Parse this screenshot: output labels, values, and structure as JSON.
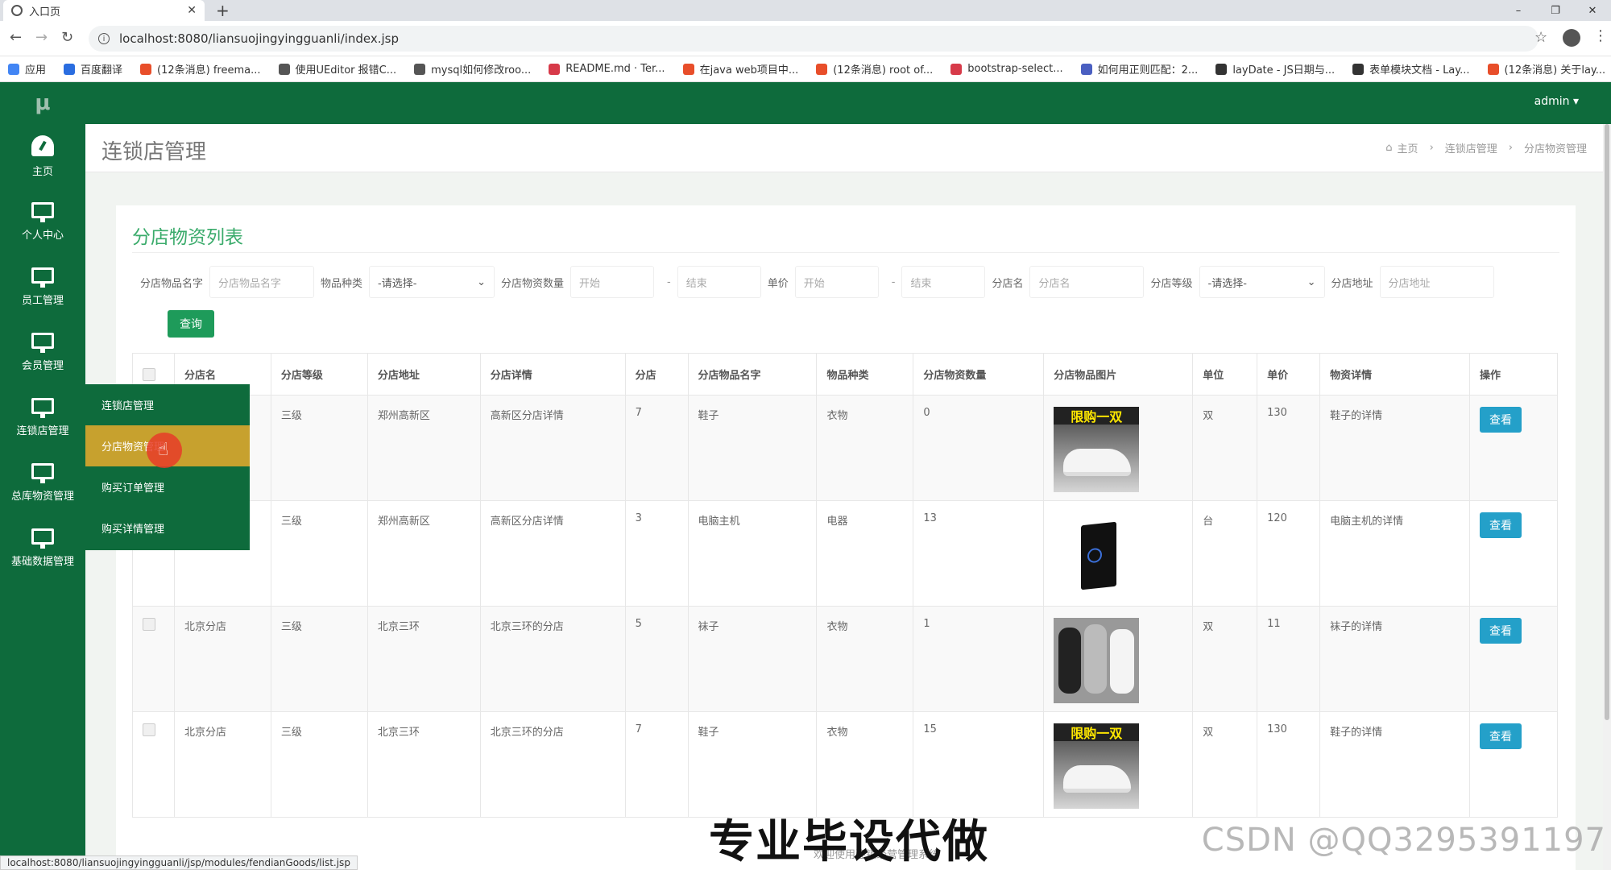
{
  "browser": {
    "tab_title": "入口页",
    "new_tab": "+",
    "url": "localhost:8080/liansuojingyingguanli/index.jsp",
    "window_controls": [
      "–",
      "❐",
      "✕"
    ],
    "bookmarks": [
      {
        "label": "应用",
        "color": "#4285f4"
      },
      {
        "label": "百度翻译",
        "color": "#2a6de0"
      },
      {
        "label": "(12条消息) freema...",
        "color": "#e84e2a"
      },
      {
        "label": "使用UEditor 报错C...",
        "color": "#555555"
      },
      {
        "label": "mysql如何修改roo...",
        "color": "#555555"
      },
      {
        "label": "README.md · Ter...",
        "color": "#d73a49"
      },
      {
        "label": "在java web项目中...",
        "color": "#e84e2a"
      },
      {
        "label": "(12条消息) root of...",
        "color": "#e84e2a"
      },
      {
        "label": "bootstrap-select...",
        "color": "#d73a49"
      },
      {
        "label": "如何用正则匹配：2...",
        "color": "#4a5fc1"
      },
      {
        "label": "layDate - JS日期与...",
        "color": "#333333"
      },
      {
        "label": "表单模块文档 - Lay...",
        "color": "#333333"
      },
      {
        "label": "(12条消息) 关于lay...",
        "color": "#e84e2a"
      }
    ],
    "status_url": "localhost:8080/liansuojingyingguanli/jsp/modules/fendianGoods/list.jsp"
  },
  "sidebar": {
    "logo": "μ",
    "items": [
      {
        "label": "主页",
        "icon": "dashboard-icon"
      },
      {
        "label": "个人中心",
        "icon": "monitor-icon"
      },
      {
        "label": "员工管理",
        "icon": "monitor-icon"
      },
      {
        "label": "会员管理",
        "icon": "monitor-icon"
      },
      {
        "label": "连锁店管理",
        "icon": "monitor-icon"
      },
      {
        "label": "总库物资管理",
        "icon": "monitor-icon"
      },
      {
        "label": "基础数据管理",
        "icon": "monitor-icon"
      }
    ]
  },
  "flyout": {
    "items": [
      {
        "label": "连锁店管理",
        "active": false
      },
      {
        "label": "分店物资管理",
        "active": true
      },
      {
        "label": "购买订单管理",
        "active": false
      },
      {
        "label": "购买详情管理",
        "active": false
      }
    ]
  },
  "topbar": {
    "user": "admin ▾"
  },
  "page": {
    "title": "连锁店管理",
    "breadcrumb": [
      "主页",
      "连锁店管理",
      "分店物资管理"
    ]
  },
  "card": {
    "title": "分店物资列表"
  },
  "search": {
    "goods_name_label": "分店物品名字",
    "goods_name_placeholder": "分店物品名字",
    "type_label": "物品种类",
    "type_value": "-请选择-",
    "qty_label": "分店物资数量",
    "qty_start": "开始",
    "qty_end": "结束",
    "price_label": "单价",
    "price_start": "开始",
    "price_end": "结束",
    "shop_label": "分店名",
    "shop_placeholder": "分店名",
    "level_label": "分店等级",
    "level_value": "-请选择-",
    "addr_label": "分店地址",
    "addr_placeholder": "分店地址",
    "dash": "-",
    "query_button": "查询"
  },
  "table": {
    "headers": [
      "分店名",
      "分店等级",
      "分店地址",
      "分店详情",
      "分店",
      "分店物品名字",
      "物品种类",
      "分店物资数量",
      "分店物品图片",
      "单位",
      "单价",
      "物资详情",
      "操作"
    ],
    "view_label": "查看",
    "rows": [
      {
        "shop": "",
        "level": "三级",
        "addr": "郑州高新区",
        "detail": "高新区分店详情",
        "shop_no": "7",
        "goods": "鞋子",
        "type": "衣物",
        "qty": "0",
        "img": "shoe",
        "img_banner": "限购一双",
        "unit": "双",
        "price": "130",
        "goods_detail": "鞋子的详情",
        "checkbox": false
      },
      {
        "shop": "",
        "level": "三级",
        "addr": "郑州高新区",
        "detail": "高新区分店详情",
        "shop_no": "3",
        "goods": "电脑主机",
        "type": "电器",
        "qty": "13",
        "img": "pc",
        "img_banner": "",
        "unit": "台",
        "price": "120",
        "goods_detail": "电脑主机的详情",
        "checkbox": false
      },
      {
        "shop": "北京分店",
        "level": "三级",
        "addr": "北京三环",
        "detail": "北京三环的分店",
        "shop_no": "5",
        "goods": "袜子",
        "type": "衣物",
        "qty": "1",
        "img": "socks",
        "img_banner": "",
        "unit": "双",
        "price": "11",
        "goods_detail": "袜子的详情",
        "checkbox": true
      },
      {
        "shop": "北京分店",
        "level": "三级",
        "addr": "北京三环",
        "detail": "北京三环的分店",
        "shop_no": "7",
        "goods": "鞋子",
        "type": "衣物",
        "qty": "15",
        "img": "shoe",
        "img_banner": "限购一双",
        "unit": "双",
        "price": "130",
        "goods_detail": "鞋子的详情",
        "checkbox": true
      }
    ]
  },
  "overlay": {
    "watermark_main": "专业毕设代做",
    "watermark_sub": "欢迎使用连锁经营管理系统",
    "watermark_csdn": "CSDN @QQ3295391197"
  },
  "colors": {
    "sidebar_green": "#0e6b3c",
    "accent_green": "#3aab6b",
    "query_green": "#1e9b5a",
    "active_gold": "#c7a12e",
    "view_blue": "#24a0c9"
  }
}
